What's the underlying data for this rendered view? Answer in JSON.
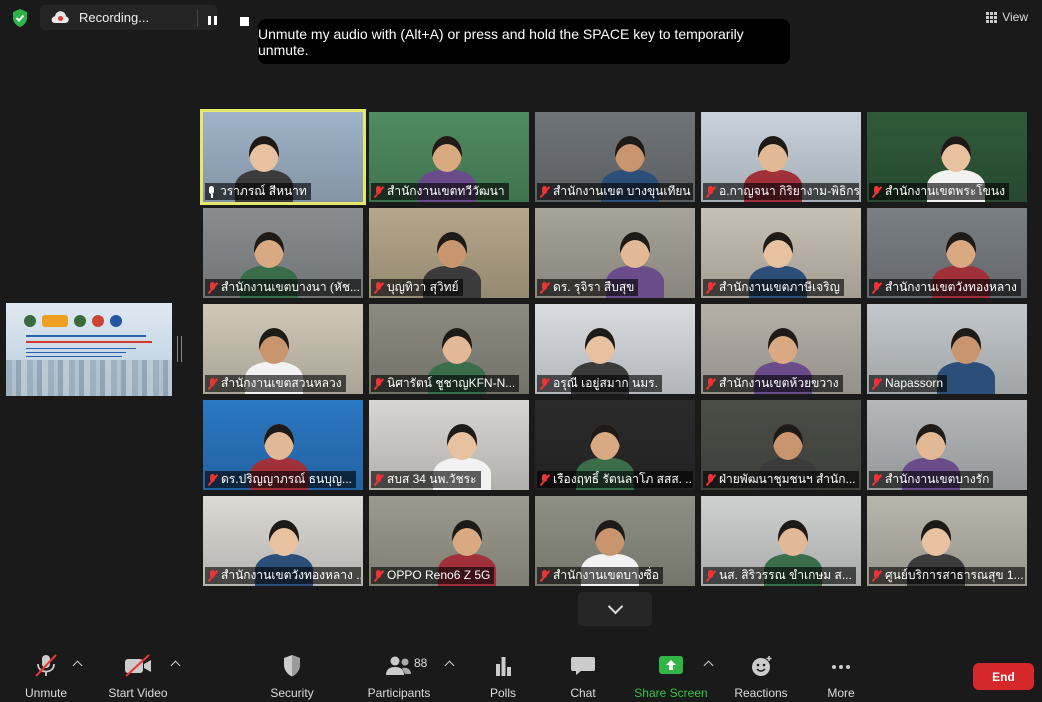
{
  "recording": {
    "label": "Recording...",
    "icon": "cloud-record-icon"
  },
  "view": {
    "label": "View"
  },
  "tooltip": {
    "text": "Unmute my audio with (Alt+A) or press and hold the SPACE key to temporarily unmute."
  },
  "participants": [
    {
      "name": "วราภรณ์ สีหนาท",
      "muted": false,
      "active": true,
      "bg": "#9fb4c9"
    },
    {
      "name": "สำนักงานเขตทวีวัฒนา",
      "muted": true,
      "bg": "#4f8c60"
    },
    {
      "name": "สำนักงานเขต บางขุนเทียน",
      "muted": true,
      "bg": "#6f7478"
    },
    {
      "name": "อ.กาญจนา กิริยางาม-พิธิกร",
      "muted": true,
      "bg": "#c9d3dc"
    },
    {
      "name": "สำนักงานเขตพระโขนง",
      "muted": true,
      "bg": "#2f5a3a"
    },
    {
      "name": "สำนักงานเขตบางนา (หัช...",
      "muted": true,
      "bg": "#8a8d8f"
    },
    {
      "name": "บุญทิวา สุวิทย์",
      "muted": true,
      "bg": "#b5a78a"
    },
    {
      "name": "ดร. รุจิรา สืบสุข",
      "muted": true,
      "bg": "#a6a39a"
    },
    {
      "name": "สำนักงานเขตภาษีเจริญ",
      "muted": true,
      "bg": "#c7c0b4"
    },
    {
      "name": "สำนักงานเขตวังทองหลาง",
      "muted": true,
      "bg": "#7a7f84"
    },
    {
      "name": "สำนักงานเขตสวนหลวง",
      "muted": true,
      "bg": "#cfc8b8"
    },
    {
      "name": "นิศารัตน์ ชูชาญKFN-N...",
      "muted": true,
      "bg": "#8b8b80"
    },
    {
      "name": "อรุณี เอยู่สมาก นมร.",
      "muted": true,
      "bg": "#d9dde2"
    },
    {
      "name": "สำนักงานเขตห้วยขวาง",
      "muted": true,
      "bg": "#b5b0a8"
    },
    {
      "name": "Napassorn",
      "muted": true,
      "bg": "#c3c8cc"
    },
    {
      "name": "ดร.ปริญญาภรณ์ ธนบุญ...",
      "muted": true,
      "bg": "#2b78c4"
    },
    {
      "name": "สบส 34 นพ.วัชระ",
      "muted": true,
      "bg": "#d8d6d2"
    },
    {
      "name": "เรืองฤทธิ์ รัตนลาโภ สสส. ...",
      "muted": true,
      "bg": "#2a2a2a"
    },
    {
      "name": "ฝ่ายพัฒนาชุมชนฯ สำนัก...",
      "muted": true,
      "bg": "#4b4d47"
    },
    {
      "name": "สำนักงานเขตบางรัก",
      "muted": true,
      "bg": "#b5b8ba"
    },
    {
      "name": "สำนักงานเขตวังทองหลาง ...",
      "muted": true,
      "bg": "#dcdad5"
    },
    {
      "name": "OPPO Reno6 Z 5G",
      "muted": true,
      "bg": "#9b9a8d"
    },
    {
      "name": "สำนักงานเขตบางซื่อ",
      "muted": true,
      "bg": "#8e9084"
    },
    {
      "name": "นส. สิริวรรณ ขำเกษม ส...",
      "muted": true,
      "bg": "#cfd1d0"
    },
    {
      "name": "ศูนย์บริการสาธารณสุข 1...",
      "muted": true,
      "bg": "#b9b6ac"
    }
  ],
  "toolbar": {
    "unmute": "Unmute",
    "start_video": "Start Video",
    "security": "Security",
    "participants": "Participants",
    "participant_count": "88",
    "polls": "Polls",
    "chat": "Chat",
    "share_screen": "Share Screen",
    "reactions": "Reactions",
    "more": "More",
    "end": "End"
  },
  "colors": {
    "share_green": "#33b545",
    "end_red": "#d6272a",
    "active_outline": "#e6e86b",
    "mute_red": "#e33"
  }
}
